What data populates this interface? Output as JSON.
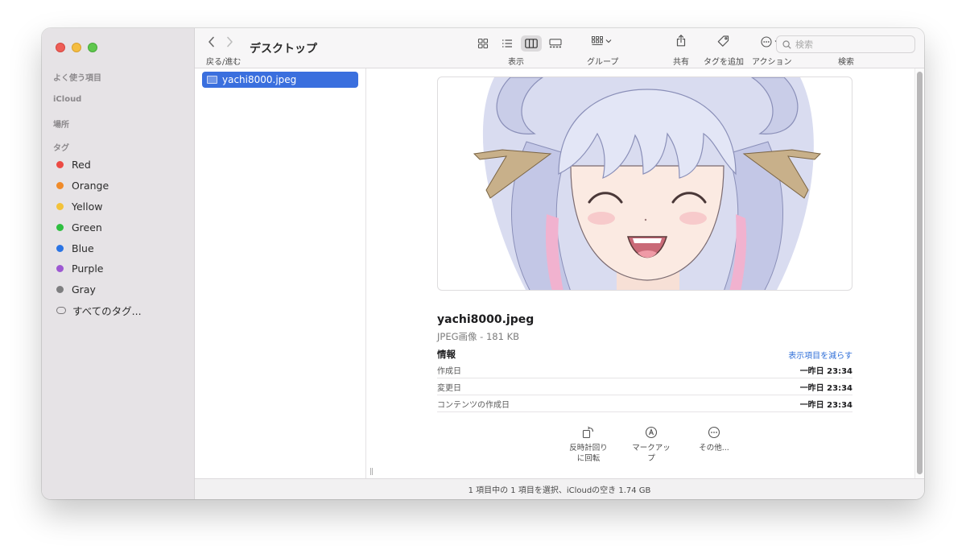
{
  "sidebar": {
    "sections": [
      "よく使う項目",
      "iCloud",
      "場所",
      "タグ"
    ],
    "tags": [
      {
        "label": "Red",
        "color": "#ec4a44"
      },
      {
        "label": "Orange",
        "color": "#f08b2a"
      },
      {
        "label": "Yellow",
        "color": "#f3c23a"
      },
      {
        "label": "Green",
        "color": "#2fbf41"
      },
      {
        "label": "Blue",
        "color": "#2b74e4"
      },
      {
        "label": "Purple",
        "color": "#9d58d2"
      },
      {
        "label": "Gray",
        "color": "#7e7e80"
      }
    ],
    "all_tags": "すべてのタグ..."
  },
  "toolbar": {
    "nav_label": "戻る/進む",
    "title": "デスクトップ",
    "view_label": "表示",
    "group_label": "グループ",
    "share_label": "共有",
    "tag_label": "タグを追加",
    "action_label": "アクション",
    "search_label": "検索",
    "search_placeholder": "検索"
  },
  "file": {
    "name": "yachi8000.jpeg"
  },
  "preview": {
    "filename": "yachi8000.jpeg",
    "kind": "JPEG画像 - 181 KB",
    "info_title": "情報",
    "show_less": "表示項目を減らす",
    "rows": [
      {
        "key": "作成日",
        "value": "一昨日 23:34"
      },
      {
        "key": "変更日",
        "value": "一昨日 23:34"
      },
      {
        "key": "コンテンツの作成日",
        "value": "一昨日 23:34"
      }
    ],
    "actions": [
      {
        "label": "反時計回り\nに回転",
        "icon": "rotate-left-icon"
      },
      {
        "label": "マークアップ",
        "icon": "markup-icon"
      },
      {
        "label": "その他...",
        "icon": "more-icon"
      }
    ]
  },
  "status": "1 項目中の 1 項目を選択、iCloudの空き 1.74 GB"
}
